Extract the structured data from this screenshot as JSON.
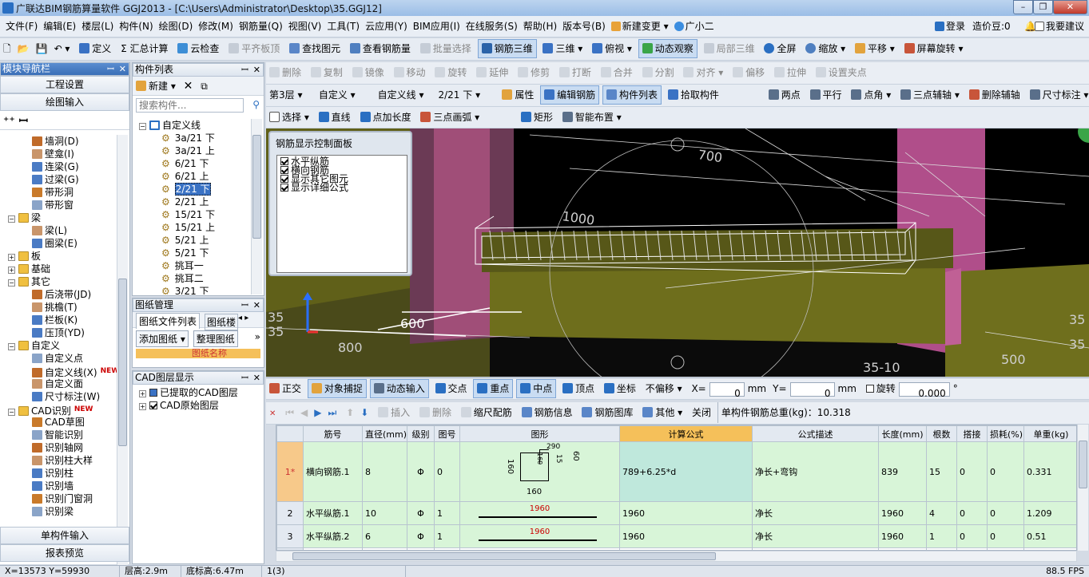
{
  "window": {
    "title": "广联达BIM钢筋算量软件 GGJ2013 - [C:\\Users\\Administrator\\Desktop\\35.GGJ12]",
    "min": "–",
    "max": "❐",
    "close": "✕"
  },
  "menu": {
    "items": [
      "文件(F)",
      "编辑(E)",
      "楼层(L)",
      "构件(N)",
      "绘图(D)",
      "修改(M)",
      "钢筋量(Q)",
      "视图(V)",
      "工具(T)",
      "云应用(Y)",
      "BIM应用(I)",
      "在线服务(S)",
      "帮助(H)",
      "版本号(B)",
      "新建变更 ▾",
      "广小二"
    ],
    "login": "登录",
    "cost_beans": "造价豆:0",
    "feedback": "我要建议"
  },
  "toolbar1": {
    "items": [
      "定义",
      "Σ 汇总计算",
      "云检查",
      "平齐板顶",
      "查找图元",
      "查看钢筋量",
      "批量选择",
      "钢筋三维",
      "三维 ▾",
      "俯视 ▾",
      "动态观察",
      "局部三维",
      "全屏",
      "缩放 ▾",
      "平移 ▾",
      "屏幕旋转 ▾"
    ]
  },
  "toolbar2": {
    "items": [
      "删除",
      "复制",
      "镜像",
      "移动",
      "旋转",
      "延伸",
      "修剪",
      "打断",
      "合并",
      "分割",
      "对齐 ▾",
      "偏移",
      "拉伸",
      "设置夹点"
    ]
  },
  "toolbar3": {
    "floor": "第3层",
    "type": "自定义",
    "subtype": "自定义线",
    "component": "2/21 下",
    "items": [
      "属性",
      "编辑钢筋",
      "构件列表",
      "拾取构件"
    ],
    "right": [
      "两点",
      "平行",
      "点角 ▾",
      "三点辅轴 ▾",
      "删除辅轴",
      "尺寸标注 ▾"
    ]
  },
  "toolbar4": {
    "items": [
      "选择 ▾",
      "直线",
      "点加长度",
      "三点画弧 ▾",
      "矩形",
      "智能布置 ▾"
    ]
  },
  "nav": {
    "title": "模块导航栏",
    "pin": "ꟷ",
    "close": "✕",
    "btn_project": "工程设置",
    "btn_draw": "绘图输入",
    "tree": [
      {
        "label": "墙洞(D)",
        "level": 2
      },
      {
        "label": "壁龛(I)",
        "level": 2
      },
      {
        "label": "连梁(G)",
        "level": 2
      },
      {
        "label": "过梁(G)",
        "level": 2
      },
      {
        "label": "带形洞",
        "level": 2
      },
      {
        "label": "带形窗",
        "level": 2
      },
      {
        "label": "梁",
        "level": 1,
        "folder": true,
        "open": true
      },
      {
        "label": "梁(L)",
        "level": 2
      },
      {
        "label": "圈梁(E)",
        "level": 2
      },
      {
        "label": "板",
        "level": 1,
        "folder": true,
        "open": false
      },
      {
        "label": "基础",
        "level": 1,
        "folder": true,
        "open": false
      },
      {
        "label": "其它",
        "level": 1,
        "folder": true,
        "open": true
      },
      {
        "label": "后浇带(JD)",
        "level": 2
      },
      {
        "label": "挑檐(T)",
        "level": 2
      },
      {
        "label": "栏板(K)",
        "level": 2
      },
      {
        "label": "压顶(YD)",
        "level": 2
      },
      {
        "label": "自定义",
        "level": 1,
        "folder": true,
        "open": true
      },
      {
        "label": "自定义点",
        "level": 2
      },
      {
        "label": "自定义线(X)",
        "level": 2,
        "new": true
      },
      {
        "label": "自定义面",
        "level": 2
      },
      {
        "label": "尺寸标注(W)",
        "level": 2
      },
      {
        "label": "CAD识别",
        "level": 1,
        "folder": true,
        "open": true,
        "new": true
      },
      {
        "label": "CAD草图",
        "level": 2
      },
      {
        "label": "智能识别",
        "level": 2
      },
      {
        "label": "识别轴网",
        "level": 2
      },
      {
        "label": "识别柱大样",
        "level": 2
      },
      {
        "label": "识别柱",
        "level": 2
      },
      {
        "label": "识别墙",
        "level": 2
      },
      {
        "label": "识别门窗洞",
        "level": 2
      },
      {
        "label": "识别梁",
        "level": 2
      }
    ],
    "new_badge": "NEW",
    "btn_single": "单构件输入",
    "btn_report": "报表预览"
  },
  "comp_list": {
    "title": "构件列表",
    "new_btn": "新建 ▾",
    "search_placeholder": "搜索构件...",
    "root": "自定义线",
    "items": [
      "3a/21 下",
      "3a/21 上",
      "6/21 下",
      "6/21 上",
      "2/21 下",
      "2/21 上",
      "15/21 下",
      "15/21 上",
      "5/21 上",
      "5/21 下",
      "挑耳一",
      "挑耳二",
      "3/21 下"
    ],
    "selected": "2/21 下"
  },
  "drawing_mgr": {
    "title": "图纸管理",
    "tab1": "图纸文件列表",
    "tab2": "图纸楼",
    "add": "添加图纸",
    "arrange": "整理图纸",
    "col": "图纸名称"
  },
  "cad_layers": {
    "title": "CAD图层显示",
    "items": [
      "已提取的CAD图层",
      "CAD原始图层"
    ]
  },
  "rebar_panel": {
    "title": "钢筋显示控制面板",
    "items": [
      "水平纵筋",
      "横向钢筋",
      "显示其它图元",
      "显示详细公式"
    ]
  },
  "viewport_labels": [
    "700",
    "1000",
    "600",
    "35",
    "35",
    "35",
    "35-10",
    "500",
    "800",
    "35"
  ],
  "snapbar": {
    "items": [
      "正交",
      "对象捕捉",
      "动态输入",
      "交点",
      "重点",
      "中点",
      "顶点",
      "坐标"
    ],
    "offset": "不偏移",
    "x_label": "X=",
    "x_val": "0",
    "mm1": "mm",
    "y_label": "Y=",
    "y_val": "0",
    "mm2": "mm",
    "rotate": "旋转",
    "rot_val": "0.000",
    "deg": "°"
  },
  "rebar_toolbar": {
    "items": [
      "插入",
      "删除",
      "缩尺配筋",
      "钢筋信息",
      "钢筋图库",
      "其他 ▾",
      "关闭"
    ],
    "total": "单构件钢筋总重(kg)：10.318"
  },
  "rebar_table": {
    "headers": [
      "",
      "筋号",
      "直径(mm)",
      "级别",
      "图号",
      "图形",
      "计算公式",
      "公式描述",
      "长度(mm)",
      "根数",
      "搭接",
      "损耗(%)",
      "单重(kg)"
    ],
    "rows": [
      {
        "no": "1*",
        "name": "横向钢筋.1",
        "dia": "8",
        "grade": "Φ",
        "fig": "0",
        "shape": "stirrup",
        "formula": "789+6.25*d",
        "desc": "净长+弯钩",
        "len": "839",
        "count": "15",
        "lap": "0",
        "loss": "0",
        "weight": "0.331"
      },
      {
        "no": "2",
        "name": "水平纵筋.1",
        "dia": "10",
        "grade": "Φ",
        "fig": "1",
        "shape": "1960",
        "formula": "1960",
        "desc": "净长",
        "len": "1960",
        "count": "4",
        "lap": "0",
        "loss": "0",
        "weight": "1.209"
      },
      {
        "no": "3",
        "name": "水平纵筋.2",
        "dia": "6",
        "grade": "Φ",
        "fig": "1",
        "shape": "1960",
        "formula": "1960",
        "desc": "净长",
        "len": "1960",
        "count": "1",
        "lap": "0",
        "loss": "0",
        "weight": "0.51"
      },
      {
        "no": "4",
        "name": "",
        "dia": "",
        "grade": "",
        "fig": "",
        "shape": "",
        "formula": "",
        "desc": "",
        "len": "",
        "count": "",
        "lap": "",
        "loss": "",
        "weight": ""
      }
    ],
    "stirrup_dims": {
      "left": "160",
      "top": "290",
      "right": "60",
      "bottom": "160",
      "inner": "15",
      "inner2": "160"
    }
  },
  "status": {
    "coords": "X=13573 Y=59930",
    "floor_h": "层高:2.9m",
    "base_h": "底标高:6.47m",
    "sel": "1(3)",
    "fps": "88.5 FPS"
  },
  "colors": {
    "accent": "#2a6fc2",
    "highlight_col": "#f5c05a",
    "row_green": "#d8f5d8",
    "formula_cell": "#bfe8dc"
  }
}
